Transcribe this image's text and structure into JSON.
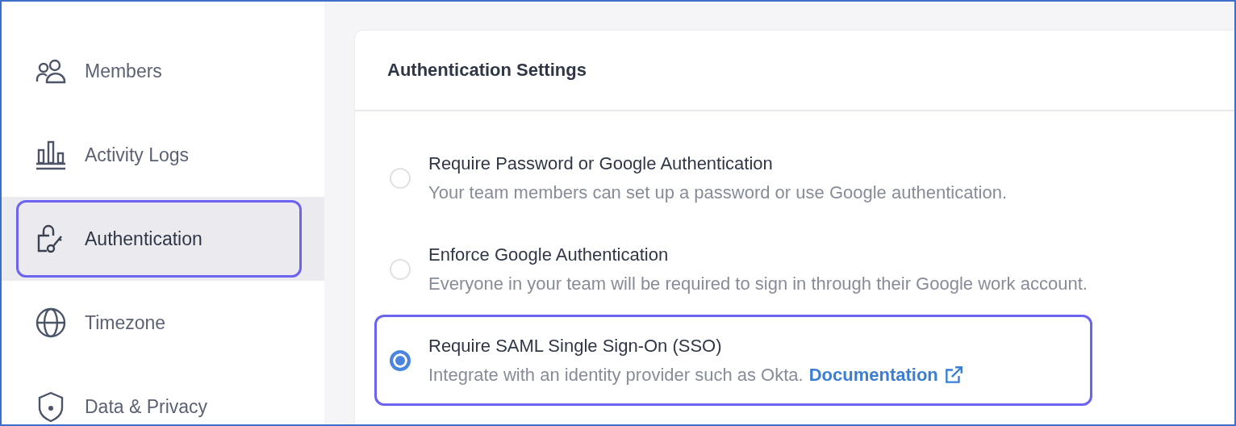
{
  "sidebar": {
    "items": [
      {
        "label": "Members",
        "kind": "members",
        "selected": false
      },
      {
        "label": "Activity Logs",
        "kind": "logs",
        "selected": false
      },
      {
        "label": "Authentication",
        "kind": "auth",
        "selected": true
      },
      {
        "label": "Timezone",
        "kind": "timezone",
        "selected": false
      },
      {
        "label": "Data & Privacy",
        "kind": "privacy",
        "selected": false
      }
    ]
  },
  "card": {
    "title": "Authentication Settings",
    "options": [
      {
        "title": "Require Password or Google Authentication",
        "description": "Your team members can set up a password or use Google authentication.",
        "selected": false
      },
      {
        "title": "Enforce Google Authentication",
        "description": "Everyone in your team will be required to sign in through their Google work account.",
        "selected": false
      },
      {
        "title": "Require SAML Single Sign-On (SSO)",
        "description": "Integrate with an identity provider such as Okta.",
        "link": "Documentation",
        "selected": true
      }
    ]
  }
}
